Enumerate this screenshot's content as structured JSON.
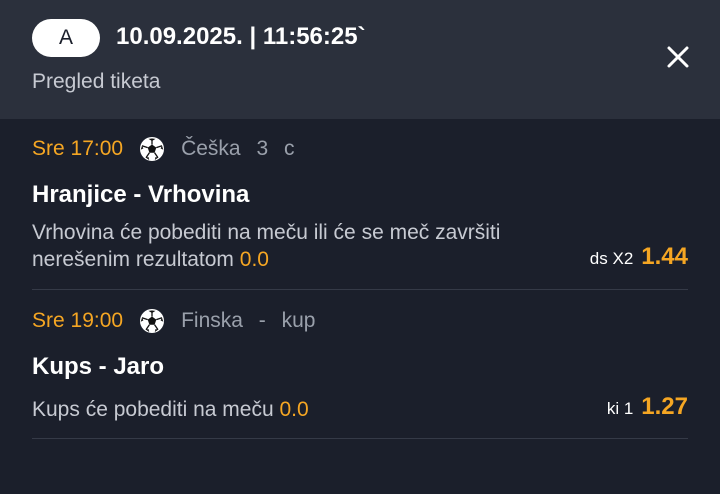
{
  "header": {
    "badge": "A",
    "datetime": "10.09.2025. | 11:56:25`",
    "subtitle": "Pregled tiketa",
    "close_icon": "close-icon"
  },
  "colors": {
    "background": "#1b1f2b",
    "header_bg": "#2b303c",
    "accent": "#f5a623",
    "text_muted": "#9aa0ab"
  },
  "bets": [
    {
      "time": "Sre 17:00",
      "sport_icon": "soccer-ball-icon",
      "league_parts": [
        "Češka",
        "3",
        "c"
      ],
      "match": "Hranjice - Vrhovina",
      "description_line1": "Vrhovina će pobediti na meču ili će se meč završiti",
      "description_line2": "nerešenim rezultatom",
      "value": "0.0",
      "pick": "ds X2",
      "odd": "1.44"
    },
    {
      "time": "Sre 19:00",
      "sport_icon": "soccer-ball-icon",
      "league_parts": [
        "Finska",
        "-",
        "kup"
      ],
      "match": "Kups - Jaro",
      "description_line1": "Kups će pobediti na meču",
      "value": "0.0",
      "pick": "ki 1",
      "odd": "1.27"
    }
  ]
}
